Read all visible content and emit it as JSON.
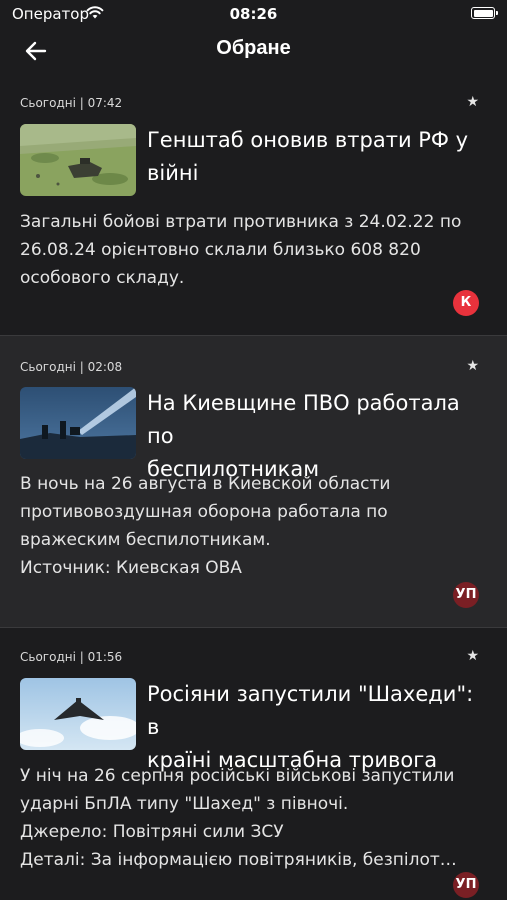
{
  "status_bar": {
    "carrier": "Оператор",
    "time": "08:26"
  },
  "header": {
    "title": "Обране"
  },
  "colors": {
    "background": "#1c1c1e",
    "card_alt": "#28282a",
    "badge_k": "#e8323c",
    "badge_up": "#7a1f24"
  },
  "articles": [
    {
      "meta": "Сьогодні | 07:42",
      "title": "Генштаб оновив втрати РФ у війні",
      "title_lines": [
        "Генштаб оновив втрати РФ у",
        "війні"
      ],
      "body_lines": [
        "Загальні бойові втрати противника з 24.02.22 по",
        "26.08.24 орієнтовно склали близько 608 820",
        "особового складу."
      ],
      "badge": "К",
      "image_icon": "battlefield-image"
    },
    {
      "meta": "Сьогодні | 02:08",
      "title": "На Киевщине ПВО работала по беспилотникам",
      "title_lines": [
        "На Киевщине ПВО работала по",
        "беспилотникам"
      ],
      "body_lines": [
        "В ночь на 26 августа в Киевской области",
        "противовоздушная оборона работала по",
        "вражеским беспилотникам.",
        "Источник: Киевская ОВА"
      ],
      "badge": "УП",
      "image_icon": "air-defense-image"
    },
    {
      "meta": "Сьогодні | 01:56",
      "title": "Росіяни запустили \"Шахеди\": в країні масштабна тривога",
      "title_lines": [
        "Росіяни запустили \"Шахеди\": в",
        "країні масштабна тривога"
      ],
      "body_lines": [
        "У ніч на 26 серпня російські військові запустили",
        "ударні БпЛА типу \"Шахед\" з півночі.",
        "Джерело: Повітряні сили ЗСУ",
        "Деталі: За інформацією повітряників, безпілот…"
      ],
      "badge": "УП",
      "image_icon": "drone-image"
    }
  ]
}
